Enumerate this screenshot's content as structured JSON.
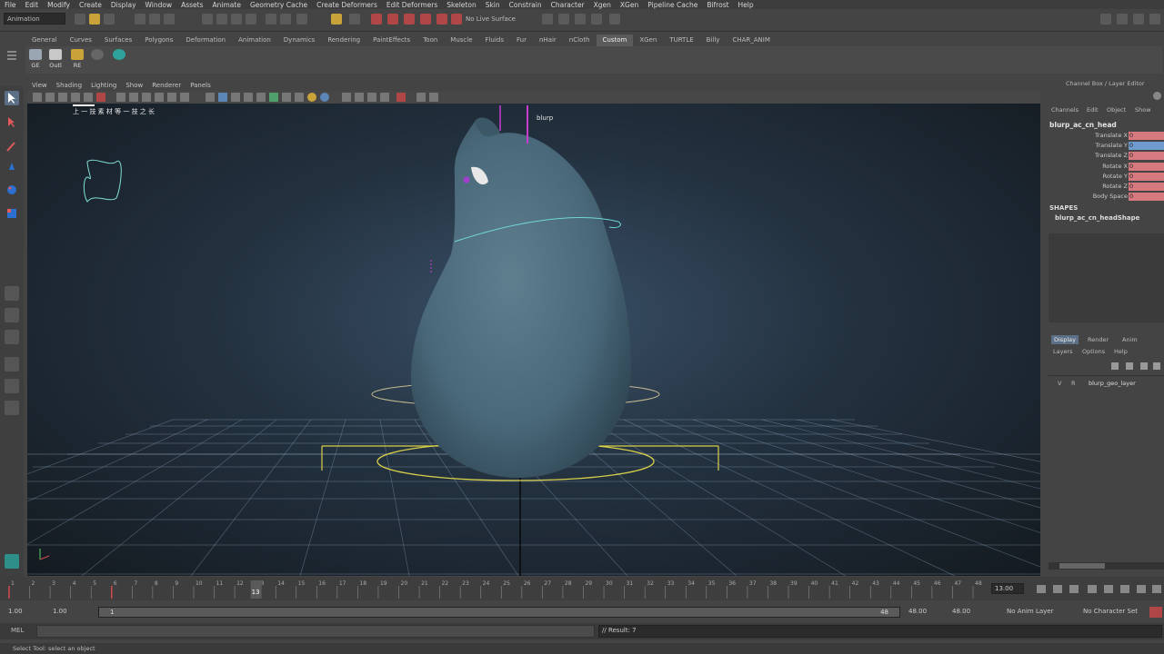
{
  "menubar": [
    "File",
    "Edit",
    "Modify",
    "Create",
    "Display",
    "Window",
    "Assets",
    "Animate",
    "Geometry Cache",
    "Create Deformers",
    "Edit Deformers",
    "Skeleton",
    "Skin",
    "Constrain",
    "Character",
    "Xgen",
    "XGen",
    "Pipeline Cache",
    "Bifrost",
    "Help"
  ],
  "status": {
    "mode": "Animation",
    "live_surface": "No Live Surface"
  },
  "shelf": {
    "tabs": [
      "General",
      "Curves",
      "Surfaces",
      "Polygons",
      "Deformation",
      "Animation",
      "Dynamics",
      "Rendering",
      "PaintEffects",
      "Toon",
      "Muscle",
      "Fluids",
      "Fur",
      "nHair",
      "nCloth",
      "Custom",
      "XGen",
      "TURTLE",
      "Billy",
      "CHAR_ANIM"
    ],
    "active_tab": "Custom",
    "icons": [
      "GE",
      "Outl",
      "RE",
      ""
    ]
  },
  "viewport": {
    "menu": [
      "View",
      "Shading",
      "Lighting",
      "Show",
      "Renderer",
      "Panels"
    ],
    "hud_text": "上 一 技 素 材 等 一 技 之 长",
    "label_blurp": "blurp"
  },
  "timeline": {
    "ticks": [
      "1",
      "2",
      "3",
      "4",
      "5",
      "6",
      "7",
      "8",
      "9",
      "10",
      "11",
      "12",
      "13",
      "14",
      "15",
      "16",
      "17",
      "18",
      "19",
      "20",
      "21",
      "22",
      "23",
      "24",
      "25",
      "26",
      "27",
      "28",
      "29",
      "30",
      "31",
      "32",
      "33",
      "34",
      "35",
      "36",
      "37",
      "38",
      "39",
      "40",
      "41",
      "42",
      "43",
      "44",
      "45",
      "46",
      "47",
      "48"
    ],
    "current_frame": "13",
    "current_field": "13.00"
  },
  "range": {
    "start": "1.00",
    "playback_start": "1.00",
    "slider_start": "1",
    "slider_end": "48",
    "playback_end": "48.00",
    "end": "48.00",
    "anim_layer": "No Anim Layer",
    "char_set": "No Character Set"
  },
  "command": {
    "lang": "MEL",
    "result": "// Result: 7"
  },
  "help_line": "Select Tool: select an object",
  "channelbox": {
    "title": "Channel Box / Layer Editor",
    "menus": [
      "Channels",
      "Edit",
      "Object",
      "Show"
    ],
    "object": "blurp_ac_cn_head",
    "attrs": [
      {
        "name": "Translate X",
        "value": "0",
        "color": "#d77a7f"
      },
      {
        "name": "Translate Y",
        "value": "0",
        "color": "#6f9bcf"
      },
      {
        "name": "Translate Z",
        "value": "0",
        "color": "#d77a7f"
      },
      {
        "name": "Rotate X",
        "value": "0",
        "color": "#d77a7f"
      },
      {
        "name": "Rotate Y",
        "value": "0",
        "color": "#d77a7f"
      },
      {
        "name": "Rotate Z",
        "value": "0",
        "color": "#d77a7f"
      },
      {
        "name": "Body Space",
        "value": "0",
        "color": "#d77a7f"
      }
    ],
    "shapes_header": "SHAPES",
    "shape": "blurp_ac_cn_headShape"
  },
  "layers": {
    "tabs": [
      "Display",
      "Render",
      "Anim"
    ],
    "active_tab": "Display",
    "menus": [
      "Layers",
      "Options",
      "Help"
    ],
    "items": [
      {
        "v": "V",
        "r": "R",
        "name": "blurp_geo_layer"
      }
    ]
  }
}
